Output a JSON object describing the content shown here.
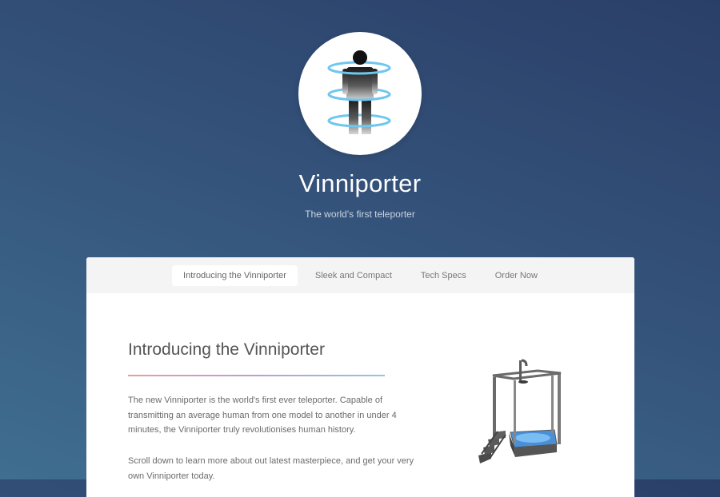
{
  "site": {
    "title": "Vinniporter",
    "tagline": "The world's first teleporter"
  },
  "nav": {
    "items": [
      {
        "label": "Introducing the Vinniporter",
        "active": true
      },
      {
        "label": "Sleek and Compact",
        "active": false
      },
      {
        "label": "Tech Specs",
        "active": false
      },
      {
        "label": "Order Now",
        "active": false
      }
    ]
  },
  "intro": {
    "heading": "Introducing the Vinniporter",
    "paragraphs": [
      "The new Vinniporter is the world's first ever teleporter. Capable of transmitting an average human from one model to another in under 4 minutes, the Vinniporter truly revolutionises human history.",
      "Scroll down to learn more about out latest masterpiece, and get your very own Vinniporter today."
    ]
  },
  "icons": {
    "logo": "person-teleport-icon",
    "product": "teleporter-booth-image"
  },
  "colors": {
    "ring_blue": "#6ec7ef",
    "heading_rule_start": "#e79ca6",
    "heading_rule_end": "#8ec6ea"
  }
}
